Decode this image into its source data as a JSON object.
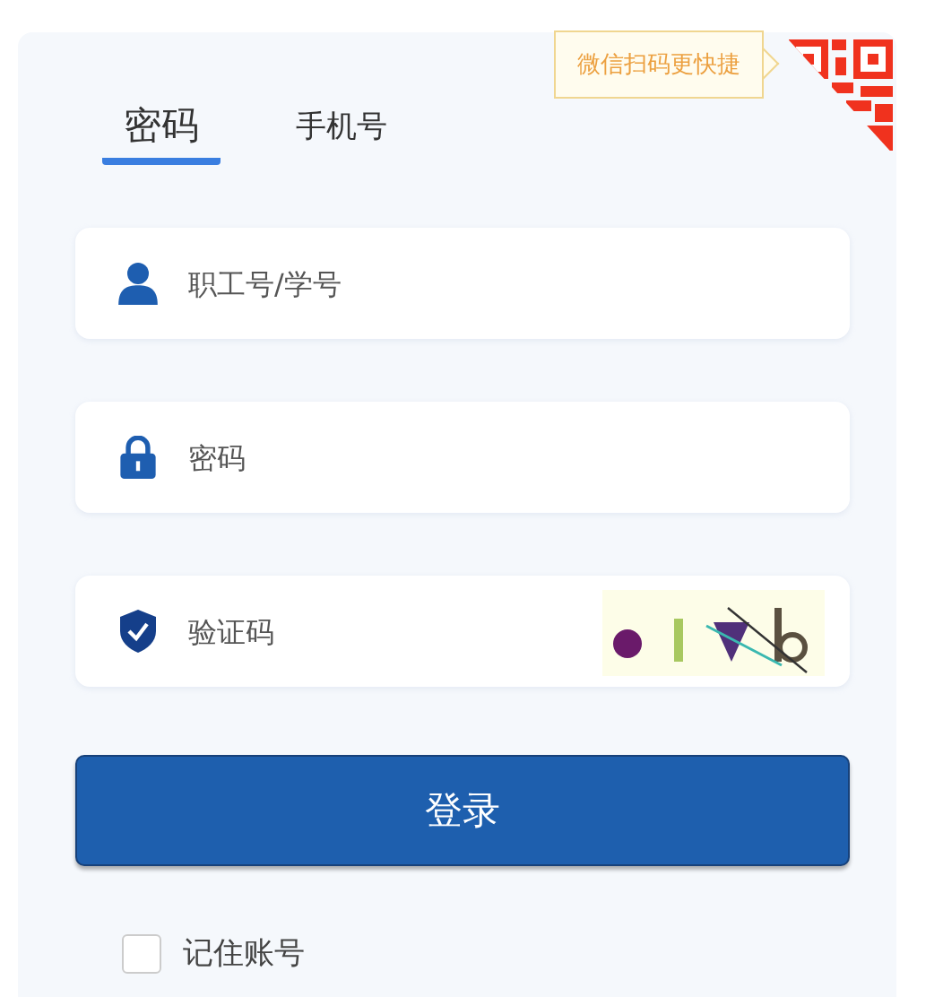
{
  "qr_tooltip": "微信扫码更快捷",
  "tabs": [
    {
      "label": "密码",
      "selected": true
    },
    {
      "label": "手机号",
      "selected": false
    }
  ],
  "fields": [
    {
      "kind": "user",
      "placeholder": "职工号/学号"
    },
    {
      "kind": "password",
      "placeholder": "密码"
    },
    {
      "kind": "captcha",
      "placeholder": "验证码"
    }
  ],
  "login_button": "登录",
  "remember": {
    "label": "记住账号",
    "checked": false
  }
}
